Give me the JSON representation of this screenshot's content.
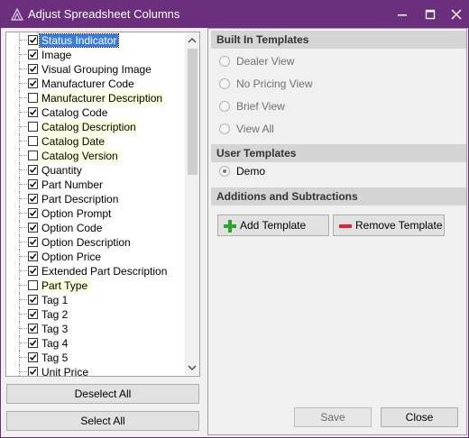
{
  "window": {
    "title": "Adjust Spreadsheet Columns",
    "minimize_icon": "minimize-icon",
    "maximize_icon": "maximize-icon",
    "close_icon": "close-icon",
    "title_bar_color": "#6b2f7d"
  },
  "columns": {
    "items": [
      {
        "label": "Status Indicator",
        "checked": true,
        "selected": true
      },
      {
        "label": "Image",
        "checked": true
      },
      {
        "label": "Visual Grouping Image",
        "checked": true
      },
      {
        "label": "Manufacturer Code",
        "checked": true
      },
      {
        "label": "Manufacturer Description",
        "checked": false
      },
      {
        "label": "Catalog Code",
        "checked": true
      },
      {
        "label": "Catalog Description",
        "checked": false
      },
      {
        "label": "Catalog Date",
        "checked": false
      },
      {
        "label": "Catalog Version",
        "checked": false
      },
      {
        "label": "Quantity",
        "checked": true
      },
      {
        "label": "Part Number",
        "checked": true
      },
      {
        "label": "Part Description",
        "checked": true
      },
      {
        "label": "Option Prompt",
        "checked": true
      },
      {
        "label": "Option Code",
        "checked": true
      },
      {
        "label": "Option Description",
        "checked": true
      },
      {
        "label": "Option Price",
        "checked": true
      },
      {
        "label": "Extended Part Description",
        "checked": true
      },
      {
        "label": "Part Type",
        "checked": false
      },
      {
        "label": "Tag 1",
        "checked": true
      },
      {
        "label": "Tag 2",
        "checked": true
      },
      {
        "label": "Tag 3",
        "checked": true
      },
      {
        "label": "Tag 4",
        "checked": true
      },
      {
        "label": "Tag 5",
        "checked": true
      },
      {
        "label": "Unit Price",
        "checked": true
      }
    ],
    "unchecked_highlight": "#ffffe1",
    "selected_color": "#3a7fd5"
  },
  "left_buttons": {
    "deselect_all": "Deselect All",
    "select_all": "Select All"
  },
  "built_in": {
    "heading": "Built In Templates",
    "options": [
      {
        "label": "Dealer View",
        "checked": false
      },
      {
        "label": "No Pricing View",
        "checked": false
      },
      {
        "label": "Brief View",
        "checked": false
      },
      {
        "label": "View All",
        "checked": false
      }
    ]
  },
  "user_templates": {
    "heading": "User Templates",
    "options": [
      {
        "label": "Demo",
        "checked": true
      }
    ]
  },
  "additions": {
    "heading": "Additions and Subtractions",
    "add_label": "Add Template",
    "remove_label": "Remove Template",
    "add_icon": "plus-icon",
    "remove_icon": "minus-icon",
    "add_color": "#2ea12e",
    "remove_color": "#d9263a"
  },
  "footer": {
    "save_label": "Save",
    "close_label": "Close"
  }
}
